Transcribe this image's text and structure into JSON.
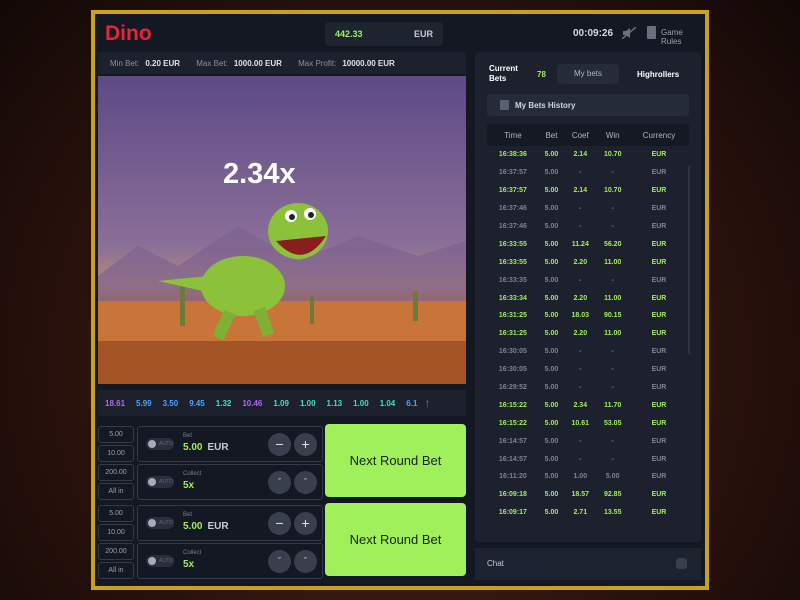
{
  "header": {
    "logo": "Dino",
    "balance": "442.33",
    "currency": "EUR",
    "clock": "00:09:26",
    "game_rules": "Game Rules"
  },
  "limits": {
    "min_label": "Min Bet:",
    "min": "0.20 EUR",
    "max_label": "Max Bet:",
    "max": "1000.00 EUR",
    "profit_label": "Max Profit:",
    "profit": "10000.00 EUR"
  },
  "game": {
    "multiplier": "2.34x"
  },
  "history": [
    {
      "v": "18.61",
      "c": "#b067f5"
    },
    {
      "v": "5.99",
      "c": "#4aa3ff"
    },
    {
      "v": "3.50",
      "c": "#4aa3ff"
    },
    {
      "v": "9.45",
      "c": "#4aa3ff"
    },
    {
      "v": "1.32",
      "c": "#3fe0c0"
    },
    {
      "v": "10.46",
      "c": "#b067f5"
    },
    {
      "v": "1.09",
      "c": "#3fe0c0"
    },
    {
      "v": "1.00",
      "c": "#3fe0c0"
    },
    {
      "v": "1.13",
      "c": "#3fe0c0"
    },
    {
      "v": "1.00",
      "c": "#3fe0c0"
    },
    {
      "v": "1.04",
      "c": "#3fe0c0"
    },
    {
      "v": "6.1",
      "c": "#4aa3ff"
    }
  ],
  "bets": [
    {
      "quick": [
        "5.00",
        "10.00",
        "200.00",
        "All in"
      ],
      "auto": "AUTO",
      "bet_label": "Bet",
      "bet": "5.00",
      "currency": "EUR",
      "collect_label": "Collect",
      "collect": "5x",
      "button": "Next Round Bet"
    },
    {
      "quick": [
        "5.00",
        "10.00",
        "200.00",
        "All in"
      ],
      "auto": "AUTO",
      "bet_label": "Bet",
      "bet": "5.00",
      "currency": "EUR",
      "collect_label": "Collect",
      "collect": "5x",
      "button": "Next Round Bet"
    }
  ],
  "side": {
    "current_bets": "Current Bets",
    "count": "78",
    "tab_my": "My bets",
    "tab_high": "Highrollers",
    "history_title": "My Bets History",
    "columns": [
      "Time",
      "Bet",
      "Coef",
      "Win",
      "Currency"
    ],
    "rows": [
      [
        "16:38:36",
        "5.00",
        "2.14",
        "10.70",
        "EUR",
        1
      ],
      [
        "16:37:57",
        "5.00",
        "-",
        "-",
        "EUR",
        0
      ],
      [
        "16:37:57",
        "5.00",
        "2.14",
        "10.70",
        "EUR",
        1
      ],
      [
        "16:37:46",
        "5.00",
        "-",
        "-",
        "EUR",
        0
      ],
      [
        "16:37:46",
        "5.00",
        "-",
        "-",
        "EUR",
        0
      ],
      [
        "16:33:55",
        "5.00",
        "11.24",
        "56.20",
        "EUR",
        1
      ],
      [
        "16:33:55",
        "5.00",
        "2.20",
        "11.00",
        "EUR",
        1
      ],
      [
        "16:33:35",
        "5.00",
        "-",
        "-",
        "EUR",
        0
      ],
      [
        "16:33:34",
        "5.00",
        "2.20",
        "11.00",
        "EUR",
        1
      ],
      [
        "16:31:25",
        "5.00",
        "18.03",
        "90.15",
        "EUR",
        1
      ],
      [
        "16:31:25",
        "5.00",
        "2.20",
        "11.00",
        "EUR",
        1
      ],
      [
        "16:30:05",
        "5.00",
        "-",
        "-",
        "EUR",
        0
      ],
      [
        "16:30:05",
        "5.00",
        "-",
        "-",
        "EUR",
        0
      ],
      [
        "16:29:52",
        "5.00",
        "-",
        "-",
        "EUR",
        0
      ],
      [
        "16:15:22",
        "5.00",
        "2.34",
        "11.70",
        "EUR",
        1
      ],
      [
        "16:15:22",
        "5.00",
        "10.61",
        "53.05",
        "EUR",
        1
      ],
      [
        "16:14:57",
        "5.00",
        "-",
        "-",
        "EUR",
        0
      ],
      [
        "16:14:57",
        "5.00",
        "-",
        "-",
        "EUR",
        0
      ],
      [
        "16:11:20",
        "5.00",
        "1.00",
        "5.00",
        "EUR",
        0
      ],
      [
        "16:09:18",
        "5.00",
        "18.57",
        "92.85",
        "EUR",
        1
      ],
      [
        "16:09:17",
        "5.00",
        "2.71",
        "13.55",
        "EUR",
        1
      ]
    ],
    "chat": "Chat"
  }
}
